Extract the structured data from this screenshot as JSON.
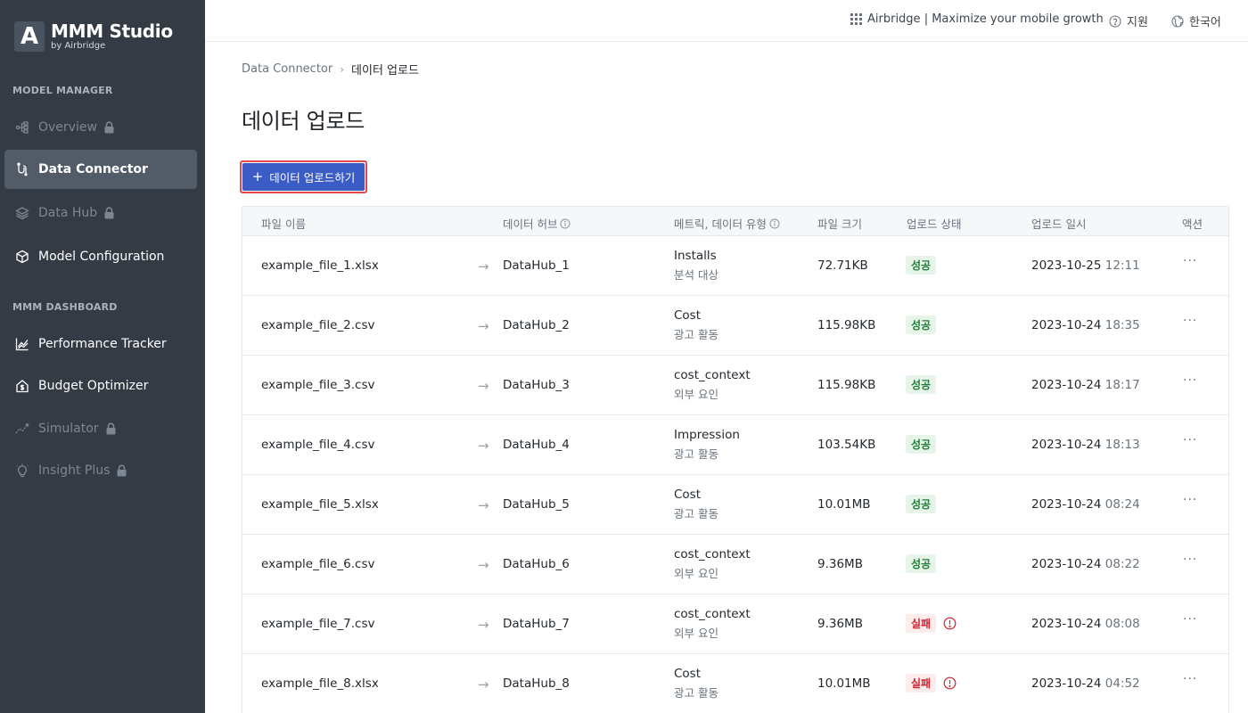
{
  "brand": {
    "logo_letter": "A",
    "title": "MMM Studio",
    "subtitle": "by Airbridge"
  },
  "sidebar": {
    "section1": "MODEL MANAGER",
    "section2": "MMM DASHBOARD",
    "items": [
      {
        "label": "Overview",
        "icon": "hierarchy-icon",
        "locked": true,
        "active": false
      },
      {
        "label": "Data Connector",
        "icon": "connector-icon",
        "locked": false,
        "active": true
      },
      {
        "label": "Data Hub",
        "icon": "layers-icon",
        "locked": true,
        "active": false
      },
      {
        "label": "Model Configuration",
        "icon": "cube-icon",
        "locked": false,
        "active": false
      },
      {
        "label": "Performance Tracker",
        "icon": "line-chart-icon",
        "locked": false,
        "active": false
      },
      {
        "label": "Budget Optimizer",
        "icon": "home-dollar-icon",
        "locked": false,
        "active": false
      },
      {
        "label": "Simulator",
        "icon": "sparkline-icon",
        "locked": true,
        "active": false
      },
      {
        "label": "Insight Plus",
        "icon": "lightbulb-icon",
        "locked": true,
        "active": false
      }
    ]
  },
  "topbar": {
    "product": "Airbridge | Maximize your mobile growth",
    "support": "지원",
    "language": "한국어"
  },
  "breadcrumb": {
    "parent": "Data Connector",
    "separator": "›",
    "current": "데이터 업로드"
  },
  "page_title": "데이터 업로드",
  "upload_button": {
    "plus": "+",
    "label": "데이터 업로드하기"
  },
  "table": {
    "headers": {
      "file_name": "파일 이름",
      "data_hub": "데이터 허브",
      "metric": "메트릭, 데이터 유형",
      "file_size": "파일 크기",
      "status": "업로드 상태",
      "date": "업로드 일시",
      "action": "액션"
    },
    "arrow": "→",
    "action_dots": "···",
    "rows": [
      {
        "file": "example_file_1.xlsx",
        "hub": "DataHub_1",
        "metric": "Installs",
        "type": "분석 대상",
        "size": "72.71KB",
        "status": "성공",
        "ok": true,
        "date": "2023-10-25",
        "time": "12:11"
      },
      {
        "file": "example_file_2.csv",
        "hub": "DataHub_2",
        "metric": "Cost",
        "type": "광고 활동",
        "size": "115.98KB",
        "status": "성공",
        "ok": true,
        "date": "2023-10-24",
        "time": "18:35"
      },
      {
        "file": "example_file_3.csv",
        "hub": "DataHub_3",
        "metric": "cost_context",
        "type": "외부 요인",
        "size": "115.98KB",
        "status": "성공",
        "ok": true,
        "date": "2023-10-24",
        "time": "18:17"
      },
      {
        "file": "example_file_4.csv",
        "hub": "DataHub_4",
        "metric": "Impression",
        "type": "광고 활동",
        "size": "103.54KB",
        "status": "성공",
        "ok": true,
        "date": "2023-10-24",
        "time": "18:13"
      },
      {
        "file": "example_file_5.xlsx",
        "hub": "DataHub_5",
        "metric": "Cost",
        "type": "광고 활동",
        "size": "10.01MB",
        "status": "성공",
        "ok": true,
        "date": "2023-10-24",
        "time": "08:24"
      },
      {
        "file": "example_file_6.csv",
        "hub": "DataHub_6",
        "metric": "cost_context",
        "type": "외부 요인",
        "size": "9.36MB",
        "status": "성공",
        "ok": true,
        "date": "2023-10-24",
        "time": "08:22"
      },
      {
        "file": "example_file_7.csv",
        "hub": "DataHub_7",
        "metric": "cost_context",
        "type": "외부 요인",
        "size": "9.36MB",
        "status": "실패",
        "ok": false,
        "date": "2023-10-24",
        "time": "08:08"
      },
      {
        "file": "example_file_8.xlsx",
        "hub": "DataHub_8",
        "metric": "Cost",
        "type": "광고 활동",
        "size": "10.01MB",
        "status": "실패",
        "ok": false,
        "date": "2023-10-24",
        "time": "04:52"
      }
    ]
  },
  "colors": {
    "sidebar_bg": "#343b45",
    "accent": "#3b5cc4",
    "success": "#1e7e34",
    "failure": "#d1242f"
  }
}
